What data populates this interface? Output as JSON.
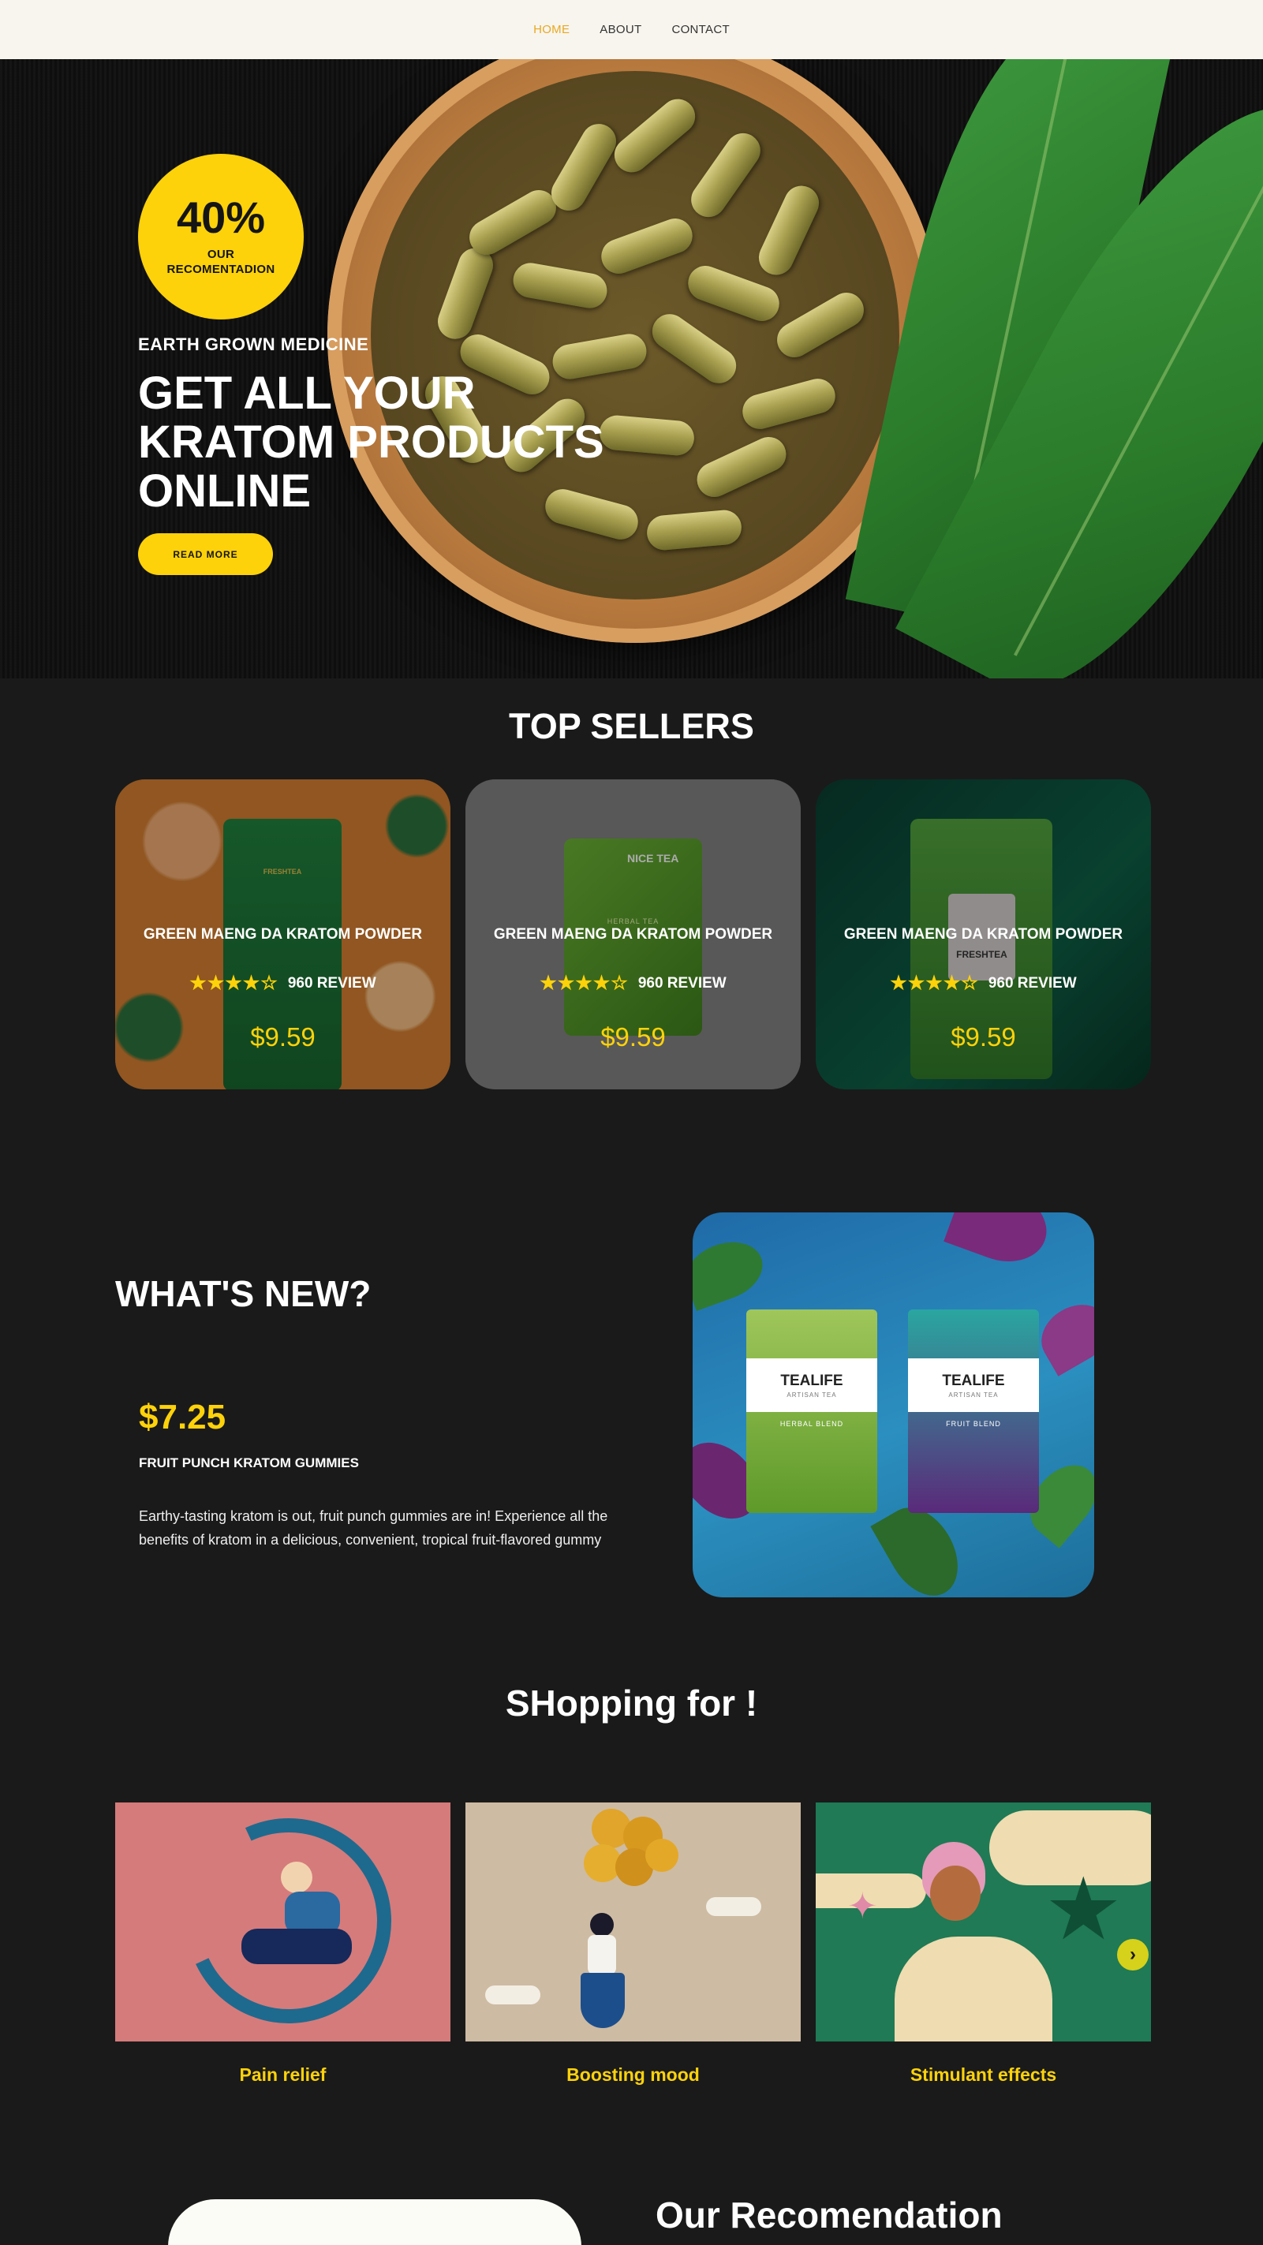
{
  "nav": {
    "items": [
      "HOME",
      "ABOUT",
      "CONTACT"
    ],
    "active": "HOME",
    "active_color": "#e8a923"
  },
  "hero": {
    "badge_value": "40%",
    "badge_label": "OUR\nRECOMENTADION",
    "eyebrow": "EARTH GROWN MEDICINE",
    "title": "GET ALL  YOUR\nKRATOM PRODUCTS\nONLINE",
    "cta": "READ MORE",
    "accent": "#fdd20a"
  },
  "top_sellers": {
    "title": "TOP SELLERS",
    "products": [
      {
        "name": "GREEN MAENG DA KRATOM POWDER",
        "stars": 4,
        "reviews": "960 REVIEW",
        "price": "$9.59",
        "pack_text": "FRESHTEA"
      },
      {
        "name": "GREEN MAENG DA KRATOM POWDER",
        "stars": 4,
        "reviews": "960 REVIEW",
        "price": "$9.59",
        "pack_text": "NICE TEA",
        "pack_sub": "HERBAL TEA"
      },
      {
        "name": "GREEN MAENG DA KRATOM POWDER",
        "stars": 4,
        "reviews": "960 REVIEW",
        "price": "$9.59",
        "pack_text": "FRESHTEA"
      }
    ]
  },
  "whats_new": {
    "title": "WHAT'S NEW?",
    "price": "$7.25",
    "product": "FRUIT PUNCH KRATOM GUMMIES",
    "description": "Earthy-tasting kratom is out, fruit punch gummies are in! Experience all the benefits of kratom in a delicious, convenient, tropical fruit-flavored gummy",
    "boxes": [
      {
        "brand": "TEALIFE",
        "tag": "ARTISAN TEA",
        "blend": "HERBAL BLEND"
      },
      {
        "brand": "TEALIFE",
        "tag": "ARTISAN TEA",
        "blend": "FRUIT BLEND"
      }
    ]
  },
  "shopping": {
    "title": "SHopping for !",
    "items": [
      {
        "label": "Pain relief",
        "bg": "#d57b7b"
      },
      {
        "label": "Boosting mood",
        "bg": "#cdbba3"
      },
      {
        "label": "Stimulant effects",
        "bg": "#1f7a55"
      }
    ],
    "next": "›"
  },
  "recommendation": {
    "title": "Our Recomendation"
  }
}
